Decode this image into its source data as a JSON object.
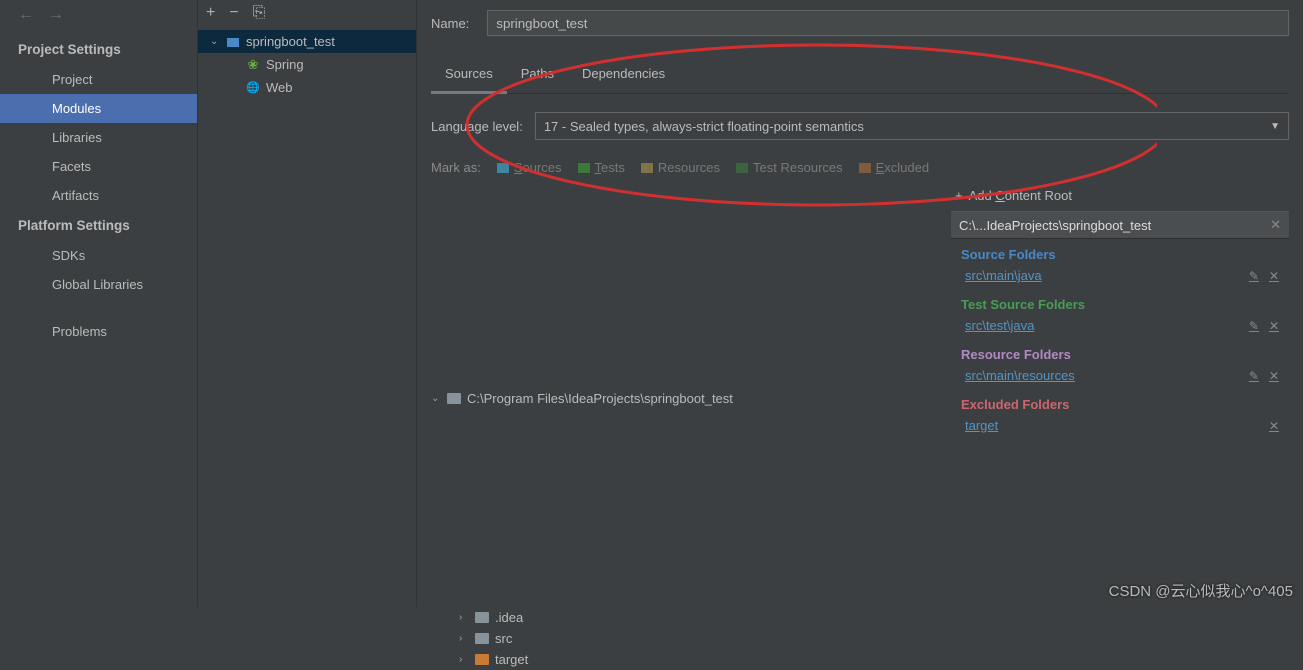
{
  "sidebar": {
    "projectSettingsLabel": "Project Settings",
    "platformSettingsLabel": "Platform Settings",
    "items": {
      "project": "Project",
      "modules": "Modules",
      "libraries": "Libraries",
      "facets": "Facets",
      "artifacts": "Artifacts",
      "sdks": "SDKs",
      "globalLibraries": "Global Libraries",
      "problems": "Problems"
    }
  },
  "moduleTree": {
    "root": "springboot_test",
    "children": {
      "spring": "Spring",
      "web": "Web"
    }
  },
  "main": {
    "nameLabel": "Name:",
    "nameValue": "springboot_test",
    "tabs": {
      "sources": "Sources",
      "paths": "Paths",
      "dependencies": "Dependencies"
    },
    "languageLevelLabel": "Language level:",
    "languageLevelValue": "17 - Sealed types, always-strict floating-point semantics",
    "markAsLabel": "Mark as:",
    "markButtons": {
      "sources": "Sources",
      "tests": "Tests",
      "resources": "Resources",
      "testResources": "Test Resources",
      "excluded": "Excluded"
    },
    "fileTree": {
      "root": "C:\\Program Files\\IdeaProjects\\springboot_test",
      "idea": ".idea",
      "src": "src",
      "target": "target"
    },
    "addContentRoot": "Add Content Root",
    "contentRootHeader": "C:\\...IdeaProjects\\springboot_test",
    "folderGroups": {
      "sourceTitle": "Source Folders",
      "sourceItem": "src\\main\\java",
      "testTitle": "Test Source Folders",
      "testItem": "src\\test\\java",
      "resourceTitle": "Resource Folders",
      "resourceItem": "src\\main\\resources",
      "excludedTitle": "Excluded Folders",
      "excludedItem": "target"
    }
  },
  "watermark": "CSDN @云心似我心^o^405"
}
